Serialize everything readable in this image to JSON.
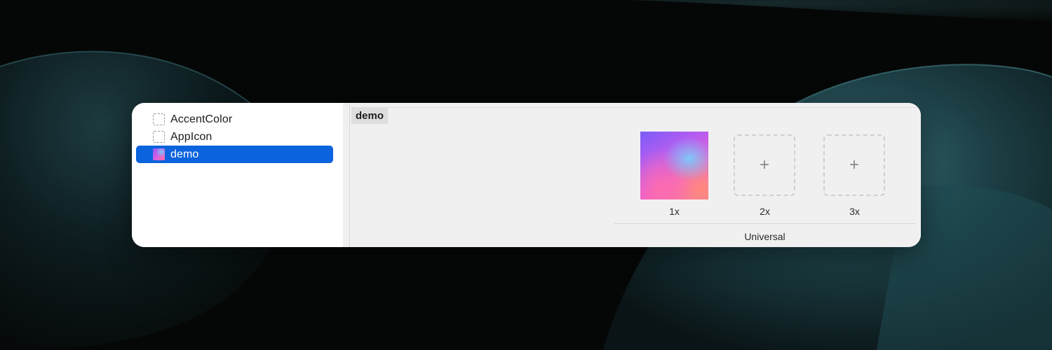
{
  "sidebar": {
    "items": [
      {
        "label": "AccentColor",
        "icon": "color-set-icon",
        "selected": false
      },
      {
        "label": "AppIcon",
        "icon": "app-icon-set-icon",
        "selected": false
      },
      {
        "label": "demo",
        "icon": "image-thumbnail-icon",
        "selected": true
      }
    ]
  },
  "editor": {
    "title": "demo",
    "slots": [
      {
        "scale": "1x",
        "filled": true
      },
      {
        "scale": "2x",
        "filled": false,
        "add_glyph": "+"
      },
      {
        "scale": "3x",
        "filled": false,
        "add_glyph": "+"
      }
    ],
    "group_label": "Universal"
  },
  "colors": {
    "selection": "#0b63dd",
    "sidebar_bg": "#ffffff",
    "editor_bg": "#f0f0f0"
  }
}
